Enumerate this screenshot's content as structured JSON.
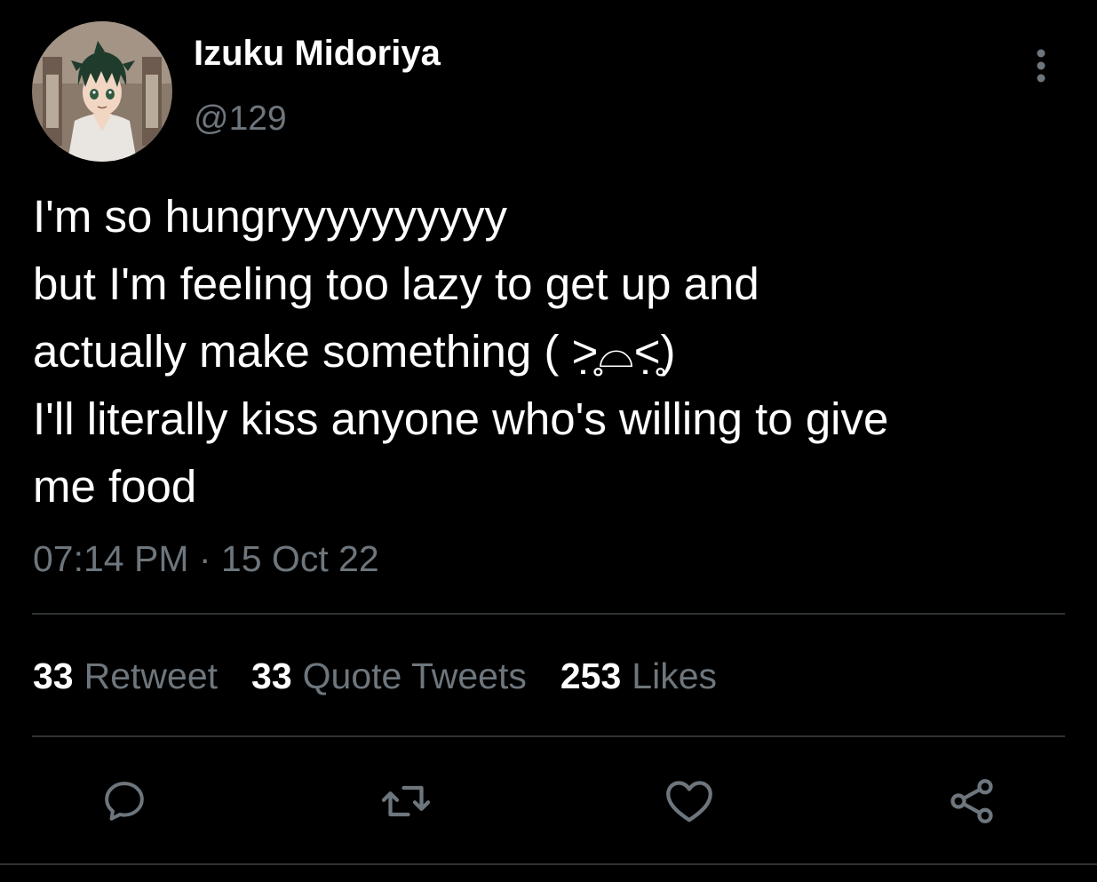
{
  "colors": {
    "background": "#000000",
    "text_primary": "#ffffff",
    "text_secondary": "#6e767d",
    "divider": "#2f3336"
  },
  "author": {
    "display_name": "Izuku Midoriya",
    "handle": "@129",
    "avatar_icon": "anime-character-avatar"
  },
  "more_menu_icon": "vertical-ellipsis-icon",
  "tweet": {
    "lines": [
      "I'm so hungryyyyyyyyyy",
      "but I'm feeling too lazy to get up and",
      "actually make something ( ˃̣̣̥⌓˂̣̣̥)",
      "I'll literally kiss anyone who's willing to give",
      "me food"
    ],
    "timestamp": "07:14 PM · 15 Oct 22"
  },
  "stats": {
    "retweets": {
      "count": "33",
      "label": "Retweet"
    },
    "quotes": {
      "count": "33",
      "label": "Quote Tweets"
    },
    "likes": {
      "count": "253",
      "label": "Likes"
    }
  },
  "actions": [
    "reply-icon",
    "retweet-icon",
    "like-icon",
    "share-icon"
  ]
}
